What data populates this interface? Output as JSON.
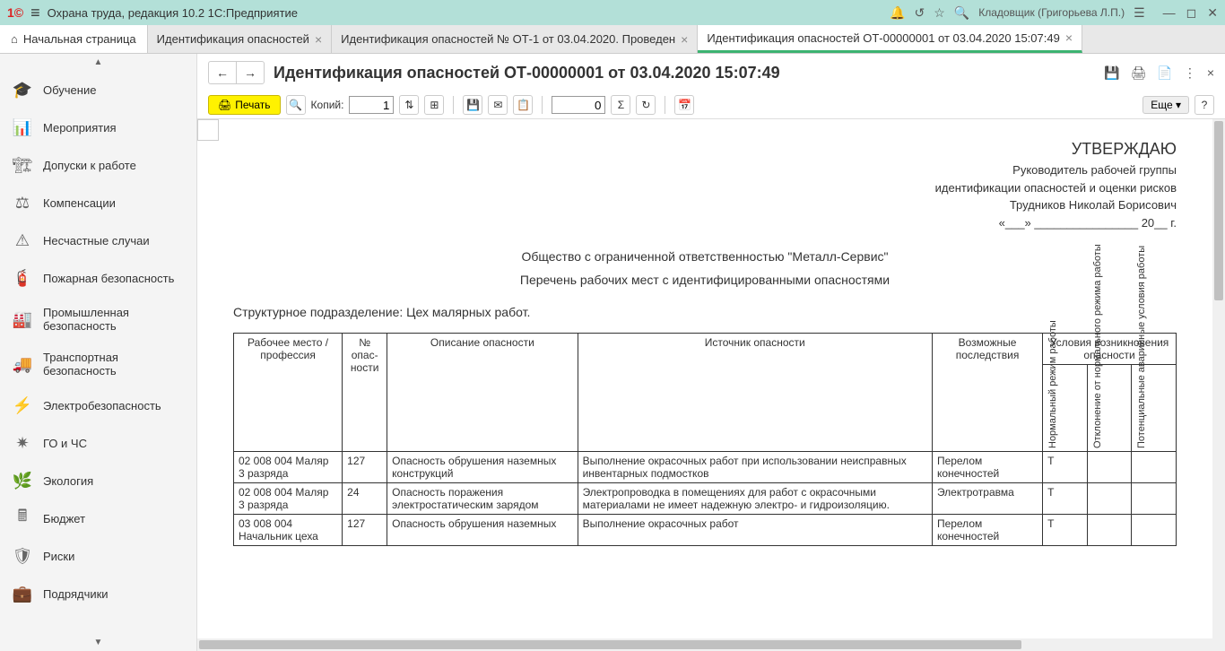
{
  "titlebar": {
    "app_title": "Охрана труда, редакция 10.2 1С:Предприятие",
    "user": "Кладовщик (Григорьева Л.П.)"
  },
  "tabs": {
    "home": "Начальная страница",
    "items": [
      {
        "label": "Идентификация опасностей"
      },
      {
        "label": "Идентификация опасностей № ОТ-1 от 03.04.2020. Проведен"
      },
      {
        "label": "Идентификация опасностей ОТ-00000001 от 03.04.2020 15:07:49"
      }
    ]
  },
  "sidebar": {
    "items": [
      {
        "label": "Обучение"
      },
      {
        "label": "Мероприятия"
      },
      {
        "label": "Допуски к работе"
      },
      {
        "label": "Компенсации"
      },
      {
        "label": "Несчастные случаи"
      },
      {
        "label": "Пожарная безопасность"
      },
      {
        "label": "Промышленная безопасность"
      },
      {
        "label": "Транспортная безопасность"
      },
      {
        "label": "Электробезопасность"
      },
      {
        "label": "ГО и ЧС"
      },
      {
        "label": "Экология"
      },
      {
        "label": "Бюджет"
      },
      {
        "label": "Риски"
      },
      {
        "label": "Подрядчики"
      }
    ]
  },
  "page": {
    "title": "Идентификация опасностей ОТ-00000001 от 03.04.2020 15:07:49"
  },
  "toolbar": {
    "print": "Печать",
    "copies_label": "Копий:",
    "copies_value": "1",
    "page_value": "0",
    "more": "Еще",
    "help": "?"
  },
  "doc": {
    "approve_title": "УТВЕРЖДАЮ",
    "approve_role1": "Руководитель рабочей группы",
    "approve_role2": "идентификации опасностей и оценки рисков",
    "approve_name": "Трудников Николай Борисович",
    "date_line": "«___» ________________ 20__ г.",
    "org": "Общество с ограниченной ответственностью \"Металл-Сервис\"",
    "subtitle": "Перечень рабочих мест с идентифицированными опасностями",
    "dept_label": "Структурное подразделение:",
    "dept_value": "Цех малярных работ.",
    "headers": {
      "workplace": "Рабочее место / профессия",
      "hazard_no": "№ опас-ности",
      "desc": "Описание опасности",
      "source": "Источник опасности",
      "consequences": "Возможные последствия",
      "conditions": "Условия возникновения опасности",
      "cond1": "Нормальный режим работы",
      "cond2": "Отклонение от нормального режима работы",
      "cond3": "Потенциальные аварийные условия работы"
    },
    "rows": [
      {
        "workplace": "02 008 004 Маляр 3 разряда",
        "no": "127",
        "desc": "Опасность обрушения наземных конструкций",
        "source": "Выполнение окрасочных работ при использовании неисправных инвентарных подмостков",
        "cons": "Перелом конечностей",
        "c1": "Т",
        "c2": "",
        "c3": ""
      },
      {
        "workplace": "02 008 004 Маляр 3 разряда",
        "no": "24",
        "desc": "Опасность поражения электростатическим зарядом",
        "source": "Электропроводка в помещениях для работ с окрасочными материалами не имеет надежную электро- и гидроизоляцию.",
        "cons": "Электротравма",
        "c1": "Т",
        "c2": "",
        "c3": ""
      },
      {
        "workplace": "03 008 004 Начальник цеха",
        "no": "127",
        "desc": "Опасность обрушения наземных",
        "source": "Выполнение окрасочных работ",
        "cons": "Перелом конечностей",
        "c1": "Т",
        "c2": "",
        "c3": ""
      }
    ]
  }
}
